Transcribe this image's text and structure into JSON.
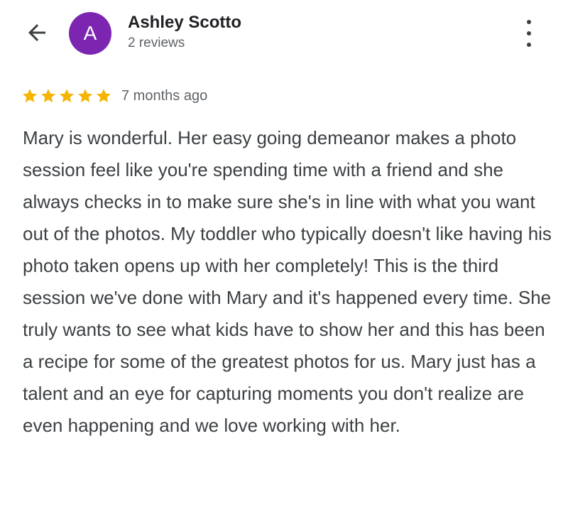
{
  "header": {
    "back_icon": "arrow-back-icon",
    "avatar_letter": "A",
    "avatar_color": "#7b25b0",
    "reviewer_name": "Ashley Scotto",
    "reviews_count": "2 reviews",
    "more_icon": "more-vert-icon"
  },
  "review": {
    "rating": 5,
    "rating_max": 5,
    "star_color": "#f4b400",
    "time_ago": "7 months ago",
    "text": "Mary is wonderful. Her easy going demeanor makes a photo session feel like you're spending time with a friend and she always checks in to make sure she's in line with what you want out of the photos. My toddler who typically doesn't like having his photo taken opens up with her completely! This is the third session we've done with Mary and it's happened every time. She truly wants to see what kids have to show her and this has been a recipe for some of the greatest photos for us. Mary just has a talent and an eye for capturing moments you don't realize are even happening and we love working with her."
  }
}
